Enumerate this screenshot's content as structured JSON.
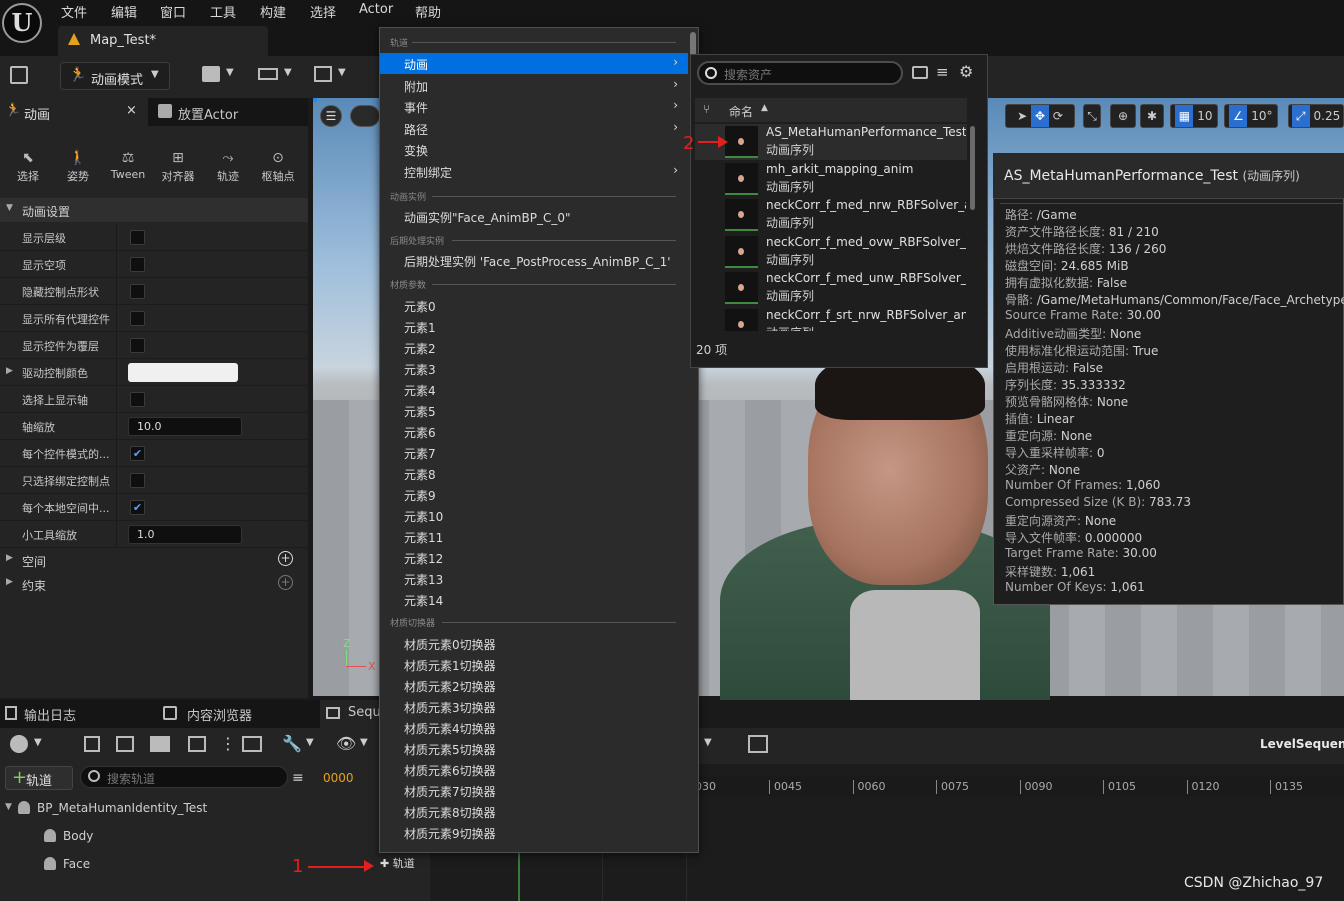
{
  "menu": {
    "items": [
      "文件",
      "编辑",
      "窗口",
      "工具",
      "构建",
      "选择",
      "Actor",
      "帮助"
    ]
  },
  "tab": {
    "title": "Map_Test*"
  },
  "toolbar": {
    "mode_label": "动画模式"
  },
  "left_panel": {
    "tab_animation": "动画",
    "tab_close": "×",
    "tab_place": "放置Actor",
    "tools": [
      "选择",
      "姿势",
      "Tween",
      "对齐器",
      "轨迹",
      "枢轴点"
    ],
    "section_anim": "动画设置",
    "properties": [
      {
        "label": "显示层级",
        "type": "check",
        "value": false
      },
      {
        "label": "显示空项",
        "type": "check",
        "value": false
      },
      {
        "label": "隐藏控制点形状",
        "type": "check",
        "value": false
      },
      {
        "label": "显示所有代理控件",
        "type": "check",
        "value": false
      },
      {
        "label": "显示控件为覆层",
        "type": "check",
        "value": false
      },
      {
        "label": "驱动控制颜色",
        "type": "color",
        "value": ""
      },
      {
        "label": "选择上显示轴",
        "type": "check",
        "value": false
      },
      {
        "label": "轴缩放",
        "type": "number",
        "value": "10.0"
      },
      {
        "label": "每个控件模式的...",
        "type": "check",
        "value": true
      },
      {
        "label": "只选择绑定控制点",
        "type": "check",
        "value": false
      },
      {
        "label": "每个本地空间中...",
        "type": "check",
        "value": true
      },
      {
        "label": "小工具缩放",
        "type": "number",
        "value": "1.0"
      }
    ],
    "section_space": "空间",
    "section_constraint": "约束"
  },
  "viewport": {
    "grid_value": "10",
    "angle_value": "10°",
    "scale_value": "0.25",
    "gizmo_z": "Z",
    "gizmo_x": "X"
  },
  "dropdown": {
    "header_track": "轨道",
    "items_top": [
      {
        "label": "动画",
        "submenu": true,
        "selected": true
      },
      {
        "label": "附加",
        "submenu": true
      },
      {
        "label": "事件",
        "submenu": true
      },
      {
        "label": "路径",
        "submenu": true
      },
      {
        "label": "变换",
        "submenu": false
      },
      {
        "label": "控制绑定",
        "submenu": true
      }
    ],
    "header_anim_instance": "动画实例",
    "anim_instance": "动画实例\"Face_AnimBP_C_0\"",
    "header_post": "后期处理实例",
    "post_instance": "后期处理实例 'Face_PostProcess_AnimBP_C_1'",
    "header_material_params": "材质参数",
    "elements": [
      "元素0",
      "元素1",
      "元素2",
      "元素3",
      "元素4",
      "元素5",
      "元素6",
      "元素7",
      "元素8",
      "元素9",
      "元素10",
      "元素11",
      "元素12",
      "元素13",
      "元素14"
    ],
    "header_material_switch": "材质切换器",
    "switchers": [
      "材质元素0切换器",
      "材质元素1切换器",
      "材质元素2切换器",
      "材质元素3切换器",
      "材质元素4切换器",
      "材质元素5切换器",
      "材质元素6切换器",
      "材质元素7切换器",
      "材质元素8切换器",
      "材质元素9切换器"
    ]
  },
  "picker": {
    "search_placeholder": "搜索资产",
    "column_name": "命名",
    "assets": [
      {
        "name": "AS_MetaHumanPerformance_Test",
        "type": "动画序列"
      },
      {
        "name": "mh_arkit_mapping_anim",
        "type": "动画序列"
      },
      {
        "name": "neckCorr_f_med_nrw_RBFSolver_anim",
        "type": "动画序列"
      },
      {
        "name": "neckCorr_f_med_ovw_RBFSolver_anim",
        "type": "动画序列"
      },
      {
        "name": "neckCorr_f_med_unw_RBFSolver_anim",
        "type": "动画序列"
      },
      {
        "name": "neckCorr_f_srt_nrw_RBFSolver_anim",
        "type": "动画序列"
      }
    ],
    "count": "20 项"
  },
  "info": {
    "title": "AS_MetaHumanPerformance_Test",
    "subtitle": "(动画序列)",
    "rows": [
      {
        "k": "路径:",
        "v": "/Game"
      },
      {
        "k": "资产文件路径长度:",
        "v": "81 / 210"
      },
      {
        "k": "烘焙文件路径长度:",
        "v": "136 / 260"
      },
      {
        "k": "磁盘空间:",
        "v": "24.685 MiB"
      },
      {
        "k": "拥有虚拟化数据:",
        "v": "False"
      },
      {
        "k": "骨骼:",
        "v": "/Game/MetaHumans/Common/Face/Face_Archetype"
      },
      {
        "k": "Source Frame Rate:",
        "v": "30.00"
      },
      {
        "k": "Additive动画类型:",
        "v": "None"
      },
      {
        "k": "使用标准化根运动范围:",
        "v": "True"
      },
      {
        "k": "启用根运动:",
        "v": "False"
      },
      {
        "k": "序列长度:",
        "v": "35.333332"
      },
      {
        "k": "预览骨骼网格体:",
        "v": "None"
      },
      {
        "k": "插值:",
        "v": "Linear"
      },
      {
        "k": "重定向源:",
        "v": "None"
      },
      {
        "k": "导入重采样帧率:",
        "v": "0"
      },
      {
        "k": "父资产:",
        "v": "None"
      },
      {
        "k": "Number Of Frames:",
        "v": "1,060"
      },
      {
        "k": "Compressed Size (K B):",
        "v": "783.73"
      },
      {
        "k": "重定向源资产:",
        "v": "None"
      },
      {
        "k": "导入文件帧率:",
        "v": "0.000000"
      },
      {
        "k": "Target Frame Rate:",
        "v": "30.00"
      },
      {
        "k": "采样键数:",
        "v": "1,061"
      },
      {
        "k": "Number Of Keys:",
        "v": "1,061"
      }
    ]
  },
  "bottom": {
    "tab_output": "输出日志",
    "tab_content": "内容浏览器",
    "tab_sequencer": "Sequ",
    "add_track": "轨道",
    "track_search_placeholder": "搜索轨道",
    "frame": "0000",
    "tree": [
      {
        "label": "BP_MetaHumanIdentity_Test",
        "indent": 0
      },
      {
        "label": "Body",
        "indent": 1
      },
      {
        "label": "Face",
        "indent": 1
      }
    ],
    "face_add_track": "轨道",
    "ruler_ticks": [
      "030",
      "0045",
      "0060",
      "0075",
      "0090",
      "0105",
      "0120",
      "0135"
    ],
    "level_sequence": "LevelSequenc"
  },
  "annotations": {
    "one": "1",
    "two": "2"
  },
  "watermark": "CSDN @Zhichao_97"
}
